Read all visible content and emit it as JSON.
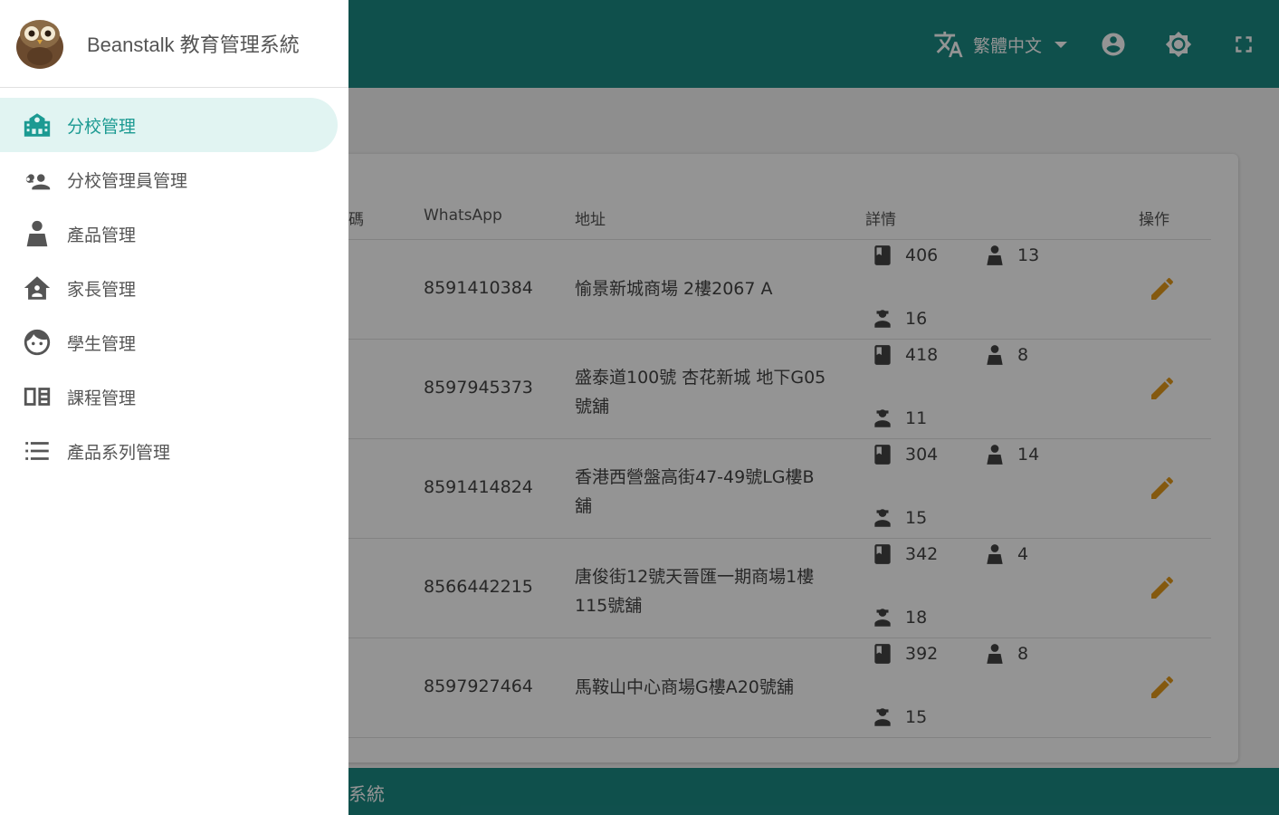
{
  "appbar": {
    "language": "繁體中文",
    "icons": [
      "translate-icon",
      "account-circle-icon",
      "brightness-icon",
      "fullscreen-icon"
    ]
  },
  "drawer": {
    "title": "Beanstalk 教育管理系統",
    "items": [
      {
        "label": "分校管理",
        "icon": "school-icon",
        "active": true
      },
      {
        "label": "分校管理員管理",
        "icon": "admin-key-icon",
        "active": false
      },
      {
        "label": "產品管理",
        "icon": "product-user-icon",
        "active": false
      },
      {
        "label": "家長管理",
        "icon": "home-icon",
        "active": false
      },
      {
        "label": "學生管理",
        "icon": "face-icon",
        "active": false
      },
      {
        "label": "課程管理",
        "icon": "book-icon",
        "active": false
      },
      {
        "label": "產品系列管理",
        "icon": "list-icon",
        "active": false
      }
    ]
  },
  "table": {
    "headers": {
      "partial": "碼",
      "whatsapp": "WhatsApp",
      "address": "地址",
      "details": "詳情",
      "actions": "操作"
    },
    "rows": [
      {
        "whatsapp": "8591410384",
        "address": "愉景新城商場 2樓2067 A",
        "books": "406",
        "staff": "13",
        "teachers": "16"
      },
      {
        "whatsapp": "8597945373",
        "address": "盛泰道100號 杏花新城 地下G05號舖",
        "books": "418",
        "staff": "8",
        "teachers": "11"
      },
      {
        "whatsapp": "8591414824",
        "address": "香港西營盤高街47-49號LG樓B舖",
        "books": "304",
        "staff": "14",
        "teachers": "15"
      },
      {
        "whatsapp": "8566442215",
        "address": "唐俊街12號天晉匯一期商場1樓115號舖",
        "books": "342",
        "staff": "4",
        "teachers": "18"
      },
      {
        "whatsapp": "8597927464",
        "address": "馬鞍山中心商場G樓A20號舖",
        "books": "392",
        "staff": "8",
        "teachers": "15"
      }
    ]
  },
  "footer": {
    "text": "系統"
  },
  "colors": {
    "primary": "#1b8a84",
    "accent_active": "#1b9a92",
    "edit": "#e39a1b"
  }
}
